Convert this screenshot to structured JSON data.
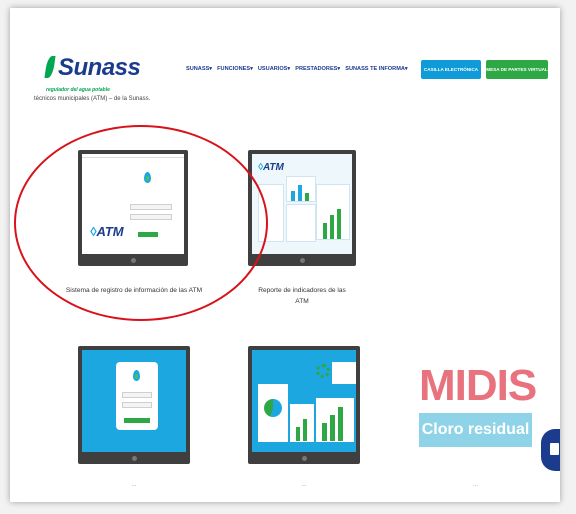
{
  "header": {
    "logo_text": "Sunass",
    "tagline": "regulador del agua potable",
    "nav_items": [
      "SUNASS▾",
      "FUNCIONES▾",
      "USUARIOS▾",
      "PRESTADORES▾",
      "SUNASS TE INFORMA▾"
    ],
    "casilla_button": "CASILLA ELECTRÓNICA",
    "mesa_button": "MESA DE PARTES VIRTUAL"
  },
  "intro_text": "técnicos municipales (ATM) – de la Sunass.",
  "cards": [
    {
      "caption": "Sistema de registro de información de las ATM",
      "screen_logo": "ATM"
    },
    {
      "caption_line1": "Reporte de indicadores de las",
      "caption_line2": "ATM",
      "screen_logo": "ATM"
    },
    {
      "caption": "..."
    },
    {
      "caption": "..."
    }
  ],
  "midis": {
    "word": "MIDIS",
    "banner": "Cloro residual",
    "caption": "..."
  },
  "colors": {
    "brand_blue": "#1b3c8c",
    "brand_green": "#00a651",
    "accent_cyan": "#0f9bd7",
    "highlight_red": "#d9121a",
    "midis_pink": "#e8727d",
    "cloro_blue": "#8fd3e8"
  },
  "icons": {
    "floating_button": "document-icon",
    "drop": "water-drop-icon"
  }
}
